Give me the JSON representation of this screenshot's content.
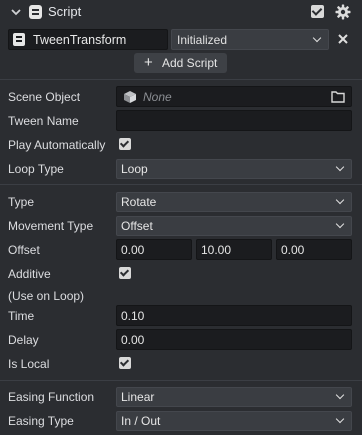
{
  "header": {
    "title": "Script",
    "enabled": true,
    "icons": [
      "chevron-down-icon",
      "script-icon",
      "checkbox-icon",
      "gear-icon"
    ]
  },
  "script": {
    "name": "TweenTransform",
    "status": "Initialized",
    "add_label": "Add Script",
    "add_symbol": "+"
  },
  "fields": {
    "scene_object": {
      "label": "Scene Object",
      "value": "None"
    },
    "tween_name": {
      "label": "Tween Name",
      "value": ""
    },
    "play_automatically": {
      "label": "Play Automatically",
      "checked": true
    },
    "loop_type": {
      "label": "Loop Type",
      "value": "Loop"
    },
    "type": {
      "label": "Type",
      "value": "Rotate"
    },
    "movement_type": {
      "label": "Movement Type",
      "value": "Offset"
    },
    "offset": {
      "label": "Offset",
      "values": [
        "0.00",
        "10.00",
        "0.00"
      ]
    },
    "additive": {
      "label": "Additive",
      "sublabel": "(Use on Loop)",
      "checked": true
    },
    "time": {
      "label": "Time",
      "value": "0.10"
    },
    "delay": {
      "label": "Delay",
      "value": "0.00"
    },
    "is_local": {
      "label": "Is Local",
      "checked": true
    },
    "easing_function": {
      "label": "Easing Function",
      "value": "Linear"
    },
    "easing_type": {
      "label": "Easing Type",
      "value": "In / Out"
    }
  },
  "colors": {
    "background": "#2b2d31",
    "field": "#1b1c1f",
    "dropdown": "#3a3d42",
    "text": "#dcdde0",
    "muted": "#8b8e93"
  }
}
